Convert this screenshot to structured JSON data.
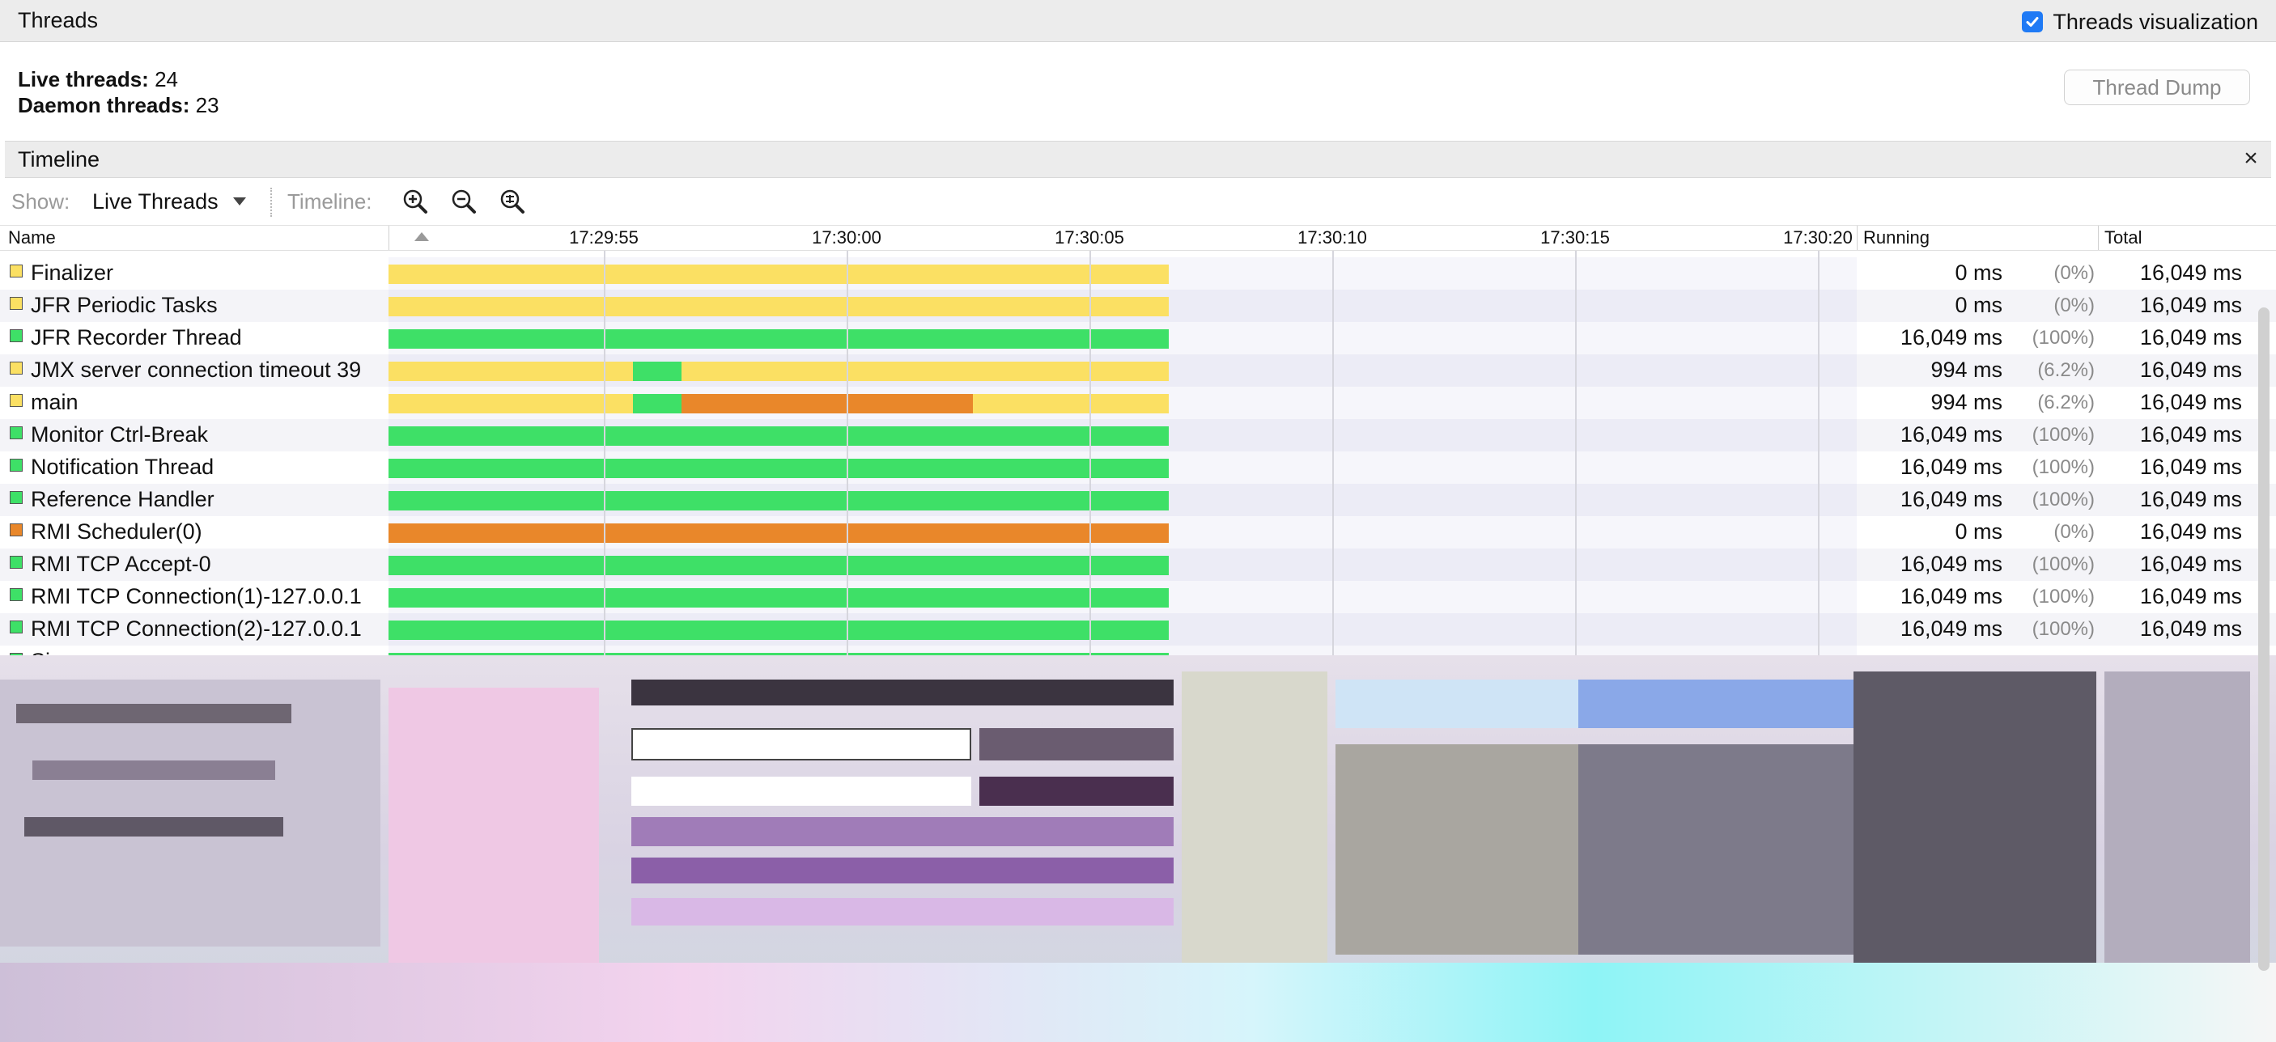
{
  "threads_panel": {
    "title": "Threads",
    "visualization_label": "Threads visualization",
    "visualization_checked": true,
    "live_threads_label": "Live threads:",
    "live_threads_value": "24",
    "daemon_threads_label": "Daemon threads:",
    "daemon_threads_value": "23",
    "thread_dump_label": "Thread Dump"
  },
  "timeline_panel": {
    "title": "Timeline",
    "close_symbol": "×",
    "show_label": "Show:",
    "show_value": "Live Threads",
    "timeline_label": "Timeline:",
    "zoom_icons": [
      "zoom-in-icon",
      "zoom-out-icon",
      "zoom-fit-icon"
    ]
  },
  "table": {
    "columns": {
      "name": "Name",
      "running": "Running",
      "total": "Total"
    },
    "ticks": [
      "17:29:55",
      "17:30:00",
      "17:30:05",
      "17:30:10",
      "17:30:15",
      "17:30:20"
    ],
    "status_colors": {
      "running": "#3ee067",
      "sleeping": "#fbe063",
      "wait": "#e9872a"
    },
    "rows": [
      {
        "name": "Finalizer",
        "state": "sleeping",
        "running": "0 ms",
        "pct": "(0%)",
        "total": "16,049 ms"
      },
      {
        "name": "JFR Periodic Tasks",
        "state": "sleeping",
        "running": "0 ms",
        "pct": "(0%)",
        "total": "16,049 ms"
      },
      {
        "name": "JFR Recorder Thread",
        "state": "running",
        "running": "16,049 ms",
        "pct": "(100%)",
        "total": "16,049 ms"
      },
      {
        "name": "JMX server connection timeout 39",
        "state": "sleeping",
        "running": "994 ms",
        "pct": "(6.2%)",
        "total": "16,049 ms"
      },
      {
        "name": "main",
        "state": "sleeping",
        "running": "994 ms",
        "pct": "(6.2%)",
        "total": "16,049 ms"
      },
      {
        "name": "Monitor Ctrl-Break",
        "state": "running",
        "running": "16,049 ms",
        "pct": "(100%)",
        "total": "16,049 ms"
      },
      {
        "name": "Notification Thread",
        "state": "running",
        "running": "16,049 ms",
        "pct": "(100%)",
        "total": "16,049 ms"
      },
      {
        "name": "Reference Handler",
        "state": "running",
        "running": "16,049 ms",
        "pct": "(100%)",
        "total": "16,049 ms"
      },
      {
        "name": "RMI Scheduler(0)",
        "state": "wait",
        "running": "0 ms",
        "pct": "(0%)",
        "total": "16,049 ms"
      },
      {
        "name": "RMI TCP Accept-0",
        "state": "running",
        "running": "16,049 ms",
        "pct": "(100%)",
        "total": "16,049 ms"
      },
      {
        "name": "RMI TCP Connection(1)-127.0.0.1",
        "state": "running",
        "running": "16,049 ms",
        "pct": "(100%)",
        "total": "16,049 ms"
      },
      {
        "name": "RMI TCP Connection(2)-127.0.0.1",
        "state": "running",
        "running": "16,049 ms",
        "pct": "(100%)",
        "total": "16,049 ms"
      },
      {
        "name": "Sign",
        "state": "running",
        "running": "",
        "pct": "",
        "total": ""
      }
    ]
  }
}
